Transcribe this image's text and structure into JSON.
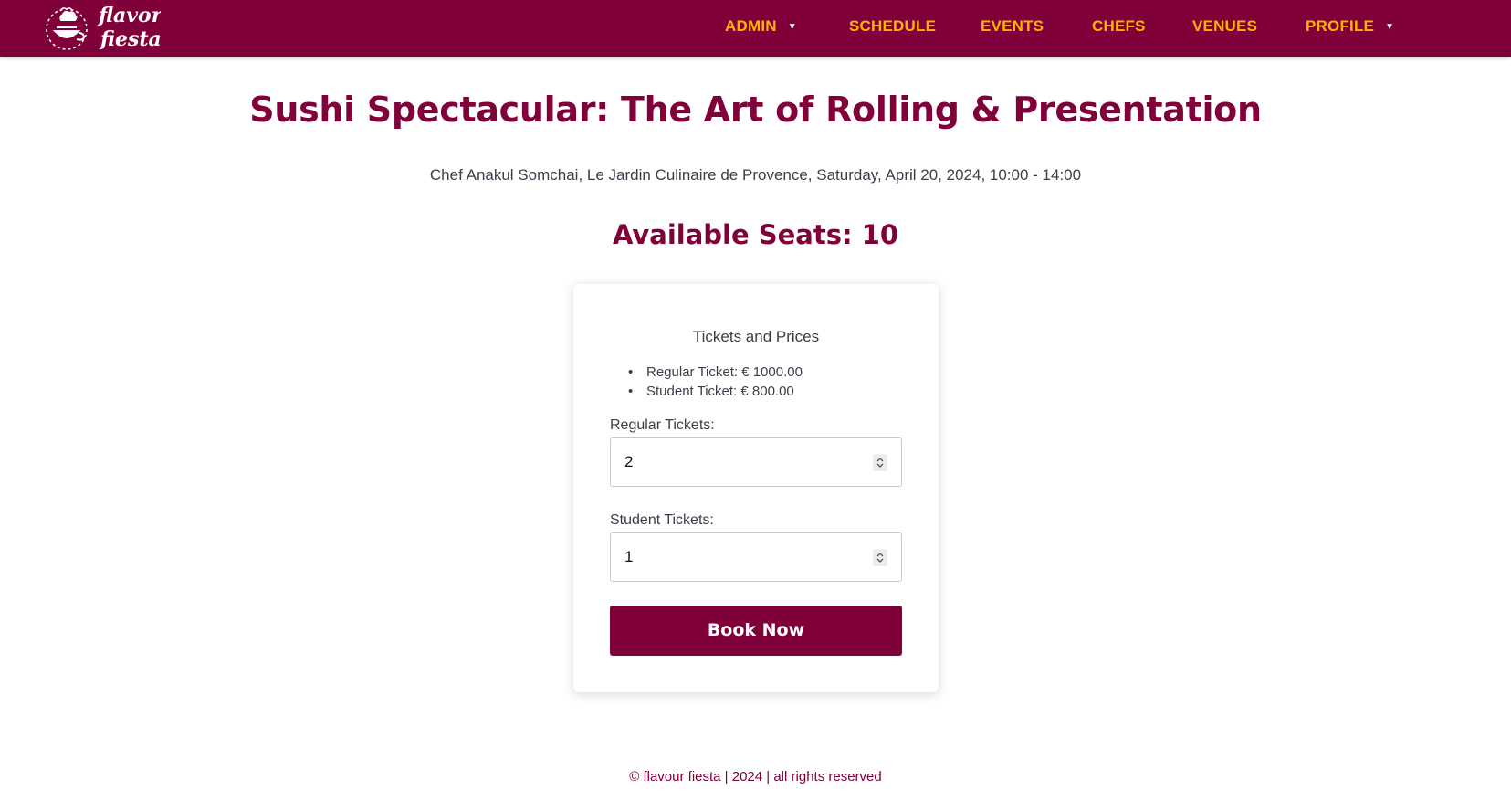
{
  "brand": {
    "name": "flavor fiesta",
    "line1": "flavor",
    "line2": "fiesta"
  },
  "nav": {
    "items": [
      {
        "label": "ADMIN",
        "has_dropdown": true
      },
      {
        "label": "SCHEDULE",
        "has_dropdown": false
      },
      {
        "label": "EVENTS",
        "has_dropdown": false
      },
      {
        "label": "CHEFS",
        "has_dropdown": false
      },
      {
        "label": "VENUES",
        "has_dropdown": false
      },
      {
        "label": "PROFILE",
        "has_dropdown": true
      }
    ]
  },
  "event": {
    "title": "Sushi Spectacular: The Art of Rolling & Presentation",
    "details": "Chef Anakul Somchai, Le Jardin Culinaire de Provence, Saturday, April 20, 2024, 10:00 - 14:00",
    "seats_label": "Available Seats: 10"
  },
  "booking": {
    "heading": "Tickets and Prices",
    "prices": [
      "Regular Ticket: € 1000.00",
      "Student Ticket: € 800.00"
    ],
    "regular_label": "Regular Tickets:",
    "regular_value": "2",
    "student_label": "Student Tickets:",
    "student_value": "1",
    "submit_label": "Book Now"
  },
  "footer": {
    "text": "© flavour fiesta | 2024 | all rights reserved"
  },
  "colors": {
    "brand": "#80003a",
    "nav_text": "#ffb300",
    "body_text": "#3a3f4a"
  }
}
